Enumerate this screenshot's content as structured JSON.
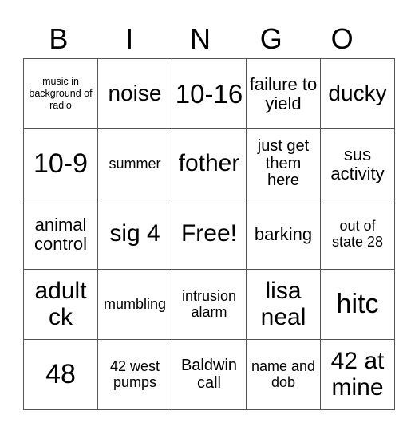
{
  "header": [
    "B",
    "I",
    "N",
    "G",
    "O"
  ],
  "cells": [
    [
      "music in background of radio",
      "noise",
      "10-16",
      "failure to yield",
      "ducky"
    ],
    [
      "10-9",
      "summer",
      "fother",
      "just get them here",
      "sus activity"
    ],
    [
      "animal control",
      "sig 4",
      "Free!",
      "barking",
      "out of state 28"
    ],
    [
      "adult ck",
      "mumbling",
      "intrusion alarm",
      "lisa neal",
      "hitc"
    ],
    [
      "48",
      "42 west pumps",
      "Baldwin call",
      "name and dob",
      "42 at mine"
    ]
  ]
}
